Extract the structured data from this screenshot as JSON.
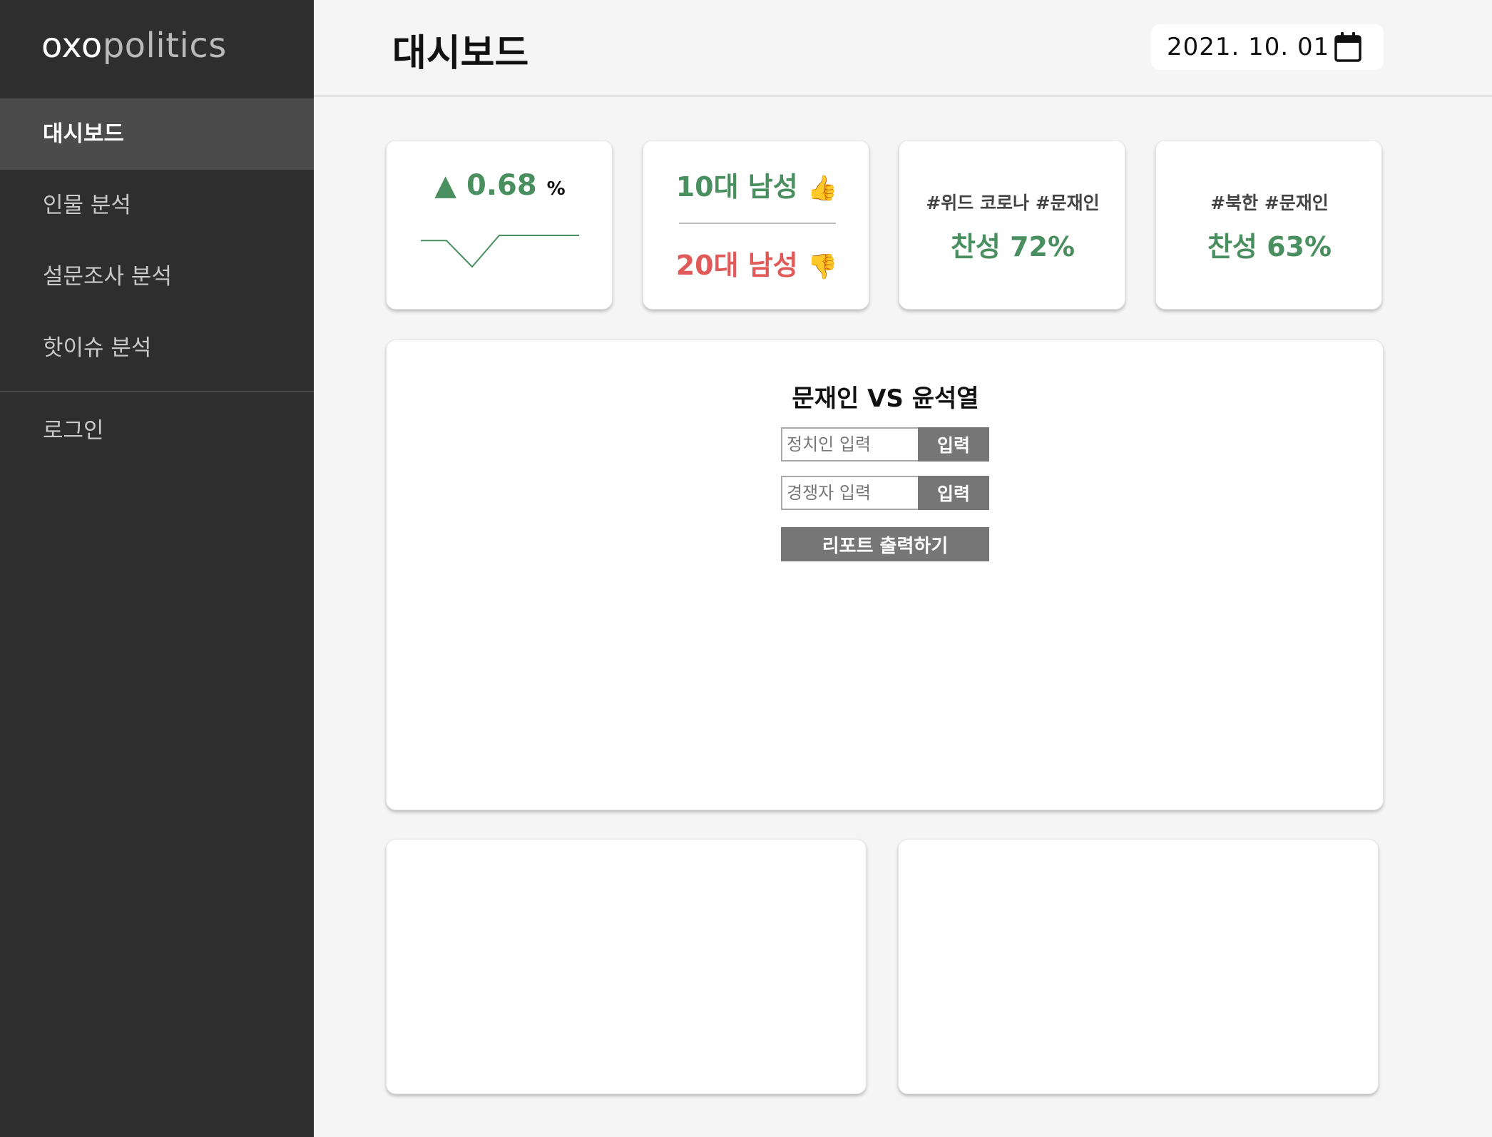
{
  "app": {
    "logo_bold": "oxo",
    "logo_light": "politics"
  },
  "sidebar": {
    "items": [
      {
        "label": "대시보드",
        "active": true
      },
      {
        "label": "인물 분석",
        "active": false
      },
      {
        "label": "설문조사 분석",
        "active": false
      },
      {
        "label": "핫이슈 분석",
        "active": false
      }
    ],
    "login_label": "로그인"
  },
  "header": {
    "title": "대시보드",
    "date": "2021. 10. 01",
    "calendar_icon": "calendar-icon"
  },
  "stats": {
    "trend": {
      "arrow": "▲",
      "value": "0.68",
      "unit": "%",
      "color": "#4a8f5f",
      "sparkline": [
        0,
        0,
        -1,
        0.2,
        0.2,
        0.2
      ]
    },
    "age_groups": {
      "positive_label": "10대 남성",
      "positive_emoji": "👍",
      "negative_label": "20대 남성",
      "negative_emoji": "👎",
      "positive_color": "#4a8f5f",
      "negative_color": "#e05a5a"
    },
    "issues": [
      {
        "tags": "#위드 코로나 #문재인",
        "approval": "찬성 72%"
      },
      {
        "tags": "#북한 #문재인",
        "approval": "찬성 63%"
      }
    ]
  },
  "compare": {
    "title": "문재인 VS 윤석열",
    "politician_placeholder": "정치인 입력",
    "rival_placeholder": "경쟁자 입력",
    "input_button_label": "입력",
    "report_button_label": "리포트 출력하기"
  }
}
